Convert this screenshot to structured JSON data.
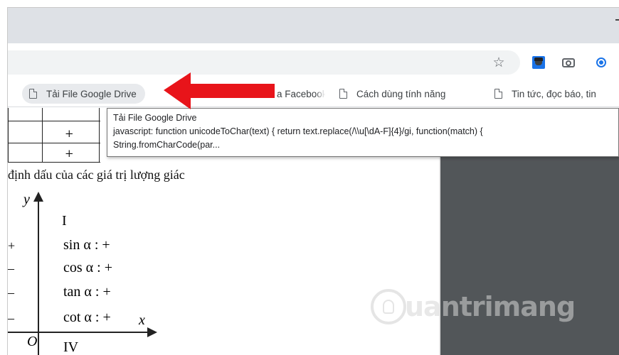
{
  "bookmarks": [
    {
      "label": "Tải File Google Drive"
    },
    {
      "label": "a Facebook"
    },
    {
      "label": "Cách dùng tính năng"
    },
    {
      "label": "Tin tức, đọc báo, tin"
    }
  ],
  "tooltip": {
    "title": "Tải File Google Drive",
    "line2": "javascript: function unicodeToChar(text) { return text.replace(/\\\\u[\\dA-F]{4}/gi, function(match) {",
    "line3": "String.fromCharCode(par..."
  },
  "document": {
    "table_cells": [
      "+",
      "+"
    ],
    "heading": "định dấu của các giá trị lượng giác",
    "axis_y": "y",
    "axis_x": "x",
    "origin": "O",
    "quadrant_1": "I",
    "quadrant_4": "IV",
    "trig_rows": [
      {
        "fn": "sin α : +",
        "sign": "+"
      },
      {
        "fn": "cos α : +",
        "sign": "–"
      },
      {
        "fn": "tan α : +",
        "sign": "–"
      },
      {
        "fn": "cot α : +",
        "sign": "–"
      }
    ]
  },
  "watermark": {
    "text": "uantrimang"
  },
  "colors": {
    "arrow": "#e8141a",
    "accent": "#1a73e8",
    "viewer_bg": "#525659"
  }
}
